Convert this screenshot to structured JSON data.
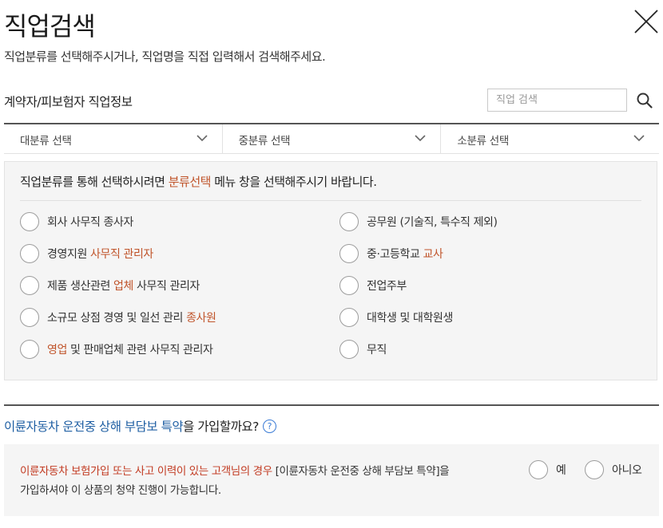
{
  "header": {
    "title": "직업검색",
    "subtitle": "직업분류를 선택해주시거나, 직업명을 직접 입력해서 검색해주세요."
  },
  "job_info": {
    "label": "계약자/피보험자 직업정보",
    "search_placeholder": "직업 검색",
    "search_value": ""
  },
  "category_selects": [
    {
      "label": "대분류 선택"
    },
    {
      "label": "중분류 선택"
    },
    {
      "label": "소분류 선택"
    }
  ],
  "quick_select": {
    "notice_before": "직업분류를 통해 선택하시려면 ",
    "notice_highlight": "분류선택",
    "notice_after": " 메뉴 창을 선택해주시기 바랍니다.",
    "options": [
      {
        "parts": [
          {
            "text": "회사 사무직 종사자",
            "hl": false
          }
        ],
        "selected": false
      },
      {
        "parts": [
          {
            "text": "공무원 (기술직, 특수직 제외)",
            "hl": false
          }
        ],
        "selected": false
      },
      {
        "parts": [
          {
            "text": "경영지원 ",
            "hl": false
          },
          {
            "text": "사무직 관리자",
            "hl": true
          }
        ],
        "selected": false
      },
      {
        "parts": [
          {
            "text": "중·고등학교 ",
            "hl": false
          },
          {
            "text": "교사",
            "hl": true
          }
        ],
        "selected": false
      },
      {
        "parts": [
          {
            "text": "제품 생산관련 ",
            "hl": false
          },
          {
            "text": "업체",
            "hl": true
          },
          {
            "text": " 사무직 관리자",
            "hl": false
          }
        ],
        "selected": false
      },
      {
        "parts": [
          {
            "text": "전업주부",
            "hl": false
          }
        ],
        "selected": false
      },
      {
        "parts": [
          {
            "text": "소규모 상점 경영 및 일선 관리 ",
            "hl": false
          },
          {
            "text": "종사원",
            "hl": true
          }
        ],
        "selected": false
      },
      {
        "parts": [
          {
            "text": "대학생 및 대학원생",
            "hl": false
          }
        ],
        "selected": false
      },
      {
        "parts": [
          {
            "text": "영업",
            "hl": true
          },
          {
            "text": " 및 판매업체 관련 사무직 관리자",
            "hl": false
          }
        ],
        "selected": false
      },
      {
        "parts": [
          {
            "text": "무직",
            "hl": false
          }
        ],
        "selected": false
      }
    ]
  },
  "rider": {
    "question_blue": "이륜자동차 운전중 상해 부담보 특약",
    "question_rest": "을 가입할까요?",
    "help_glyph": "?",
    "message_red": "이륜자동차 보험가입 또는 사고 이력이 있는 고객님의 경우",
    "message_rest": " [이륜자동차 운전중 상해 부담보 특약]을",
    "message_line2": "가입하셔야 이 상품의 청약 진행이 가능합니다.",
    "yes_label": "예",
    "no_label": "아니오",
    "selected": null
  },
  "colors": {
    "highlight": "#c0542a",
    "warning_red": "#c23b22",
    "link_blue": "#1f5fa3",
    "help_blue": "#3a7bd5",
    "panel_bg": "#f5f5f5"
  },
  "icons": {
    "close": "close-icon",
    "search": "search-icon",
    "dropdown": "chevron-down-icon",
    "help": "help-circle-icon"
  }
}
